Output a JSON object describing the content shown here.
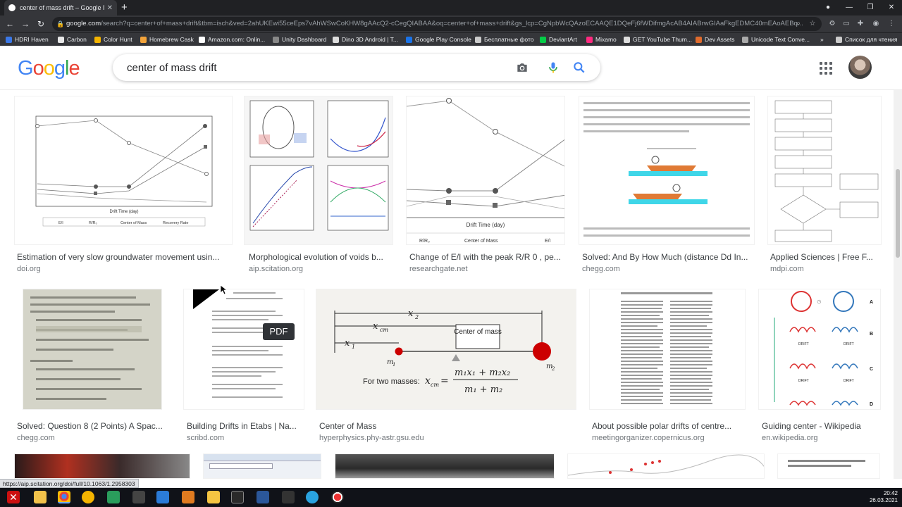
{
  "browser": {
    "tab_title": "center of mass drift – Google По",
    "address_host": "google.com",
    "address_path": "/search?q=center+of+mass+drift&tbm=isch&ved=2ahUKEwi55ceEps7vAhWSwCoKHW8gAAcQ2-cCegQIABAA&oq=center+of+mass+drift&gs_lcp=CgNpbWcQAzoECAAQE1DQeFj6fWDifmgAcAB4AIABrwGIAaFkgEDMC40mEAoAEBq...",
    "bookmarks": [
      {
        "label": "HDRI Haven",
        "color": "#3b78e7"
      },
      {
        "label": "Carbon",
        "color": "#2e2e2e"
      },
      {
        "label": "Color Hunt",
        "color": "#f4b400"
      },
      {
        "label": "Homebrew Cask",
        "color": "#f2a33a"
      },
      {
        "label": "Amazon.com: Onlin...",
        "color": "#ffffff"
      },
      {
        "label": "Unity Dashboard",
        "color": "#888888"
      },
      {
        "label": "Dino 3D Android | T...",
        "color": "#dddddd"
      },
      {
        "label": "Google Play Console",
        "color": "#1a73e8"
      },
      {
        "label": "Бесплатные фото",
        "color": "#cccccc"
      },
      {
        "label": "DeviantArt",
        "color": "#05cc47"
      },
      {
        "label": "Mixamo",
        "color": "#ff2a7f"
      },
      {
        "label": "GET YouTube Thum...",
        "color": "#dddddd"
      },
      {
        "label": "Dev Assets",
        "color": "#e06b2d"
      },
      {
        "label": "Unicode Text Conve...",
        "color": "#aaaaaa"
      },
      {
        "label": "Список для чтения",
        "color": "#cccccc"
      }
    ],
    "more_label": "»"
  },
  "google": {
    "logo_letters": [
      "G",
      "o",
      "o",
      "g",
      "l",
      "e"
    ],
    "query": "center of mass drift"
  },
  "results_row1": [
    {
      "title": "Estimation of very slow groundwater movement usin...",
      "source": "doi.org"
    },
    {
      "title": "Morphological evolution of voids b...",
      "source": "aip.scitation.org"
    },
    {
      "title": "Change of E/I with the peak R/R 0 , pe...",
      "source": "researchgate.net"
    },
    {
      "title": "Solved: And By How Much (distance Dd In...",
      "source": "chegg.com"
    },
    {
      "title": "Applied Sciences | Free F...",
      "source": "mdpi.com"
    }
  ],
  "results_row2": [
    {
      "title": "Solved: Question 8 (2 Points) A Spac...",
      "source": "chegg.com"
    },
    {
      "title": "Building Drifts in Etabs | Na...",
      "source": "scribd.com"
    },
    {
      "title": "Center of Mass",
      "source": "hyperphysics.phy-astr.gsu.edu"
    },
    {
      "title": "About possible polar drifts of centre...",
      "source": "meetingorganizer.copernicus.org"
    },
    {
      "title": "Guiding center - Wikipedia",
      "source": "en.wikipedia.org"
    }
  ],
  "thumb_texts": {
    "chart1_xlabel": "Drift Time (day)",
    "chart1_legend": [
      "E/I",
      "R/R₀",
      "Center of Mass",
      "Recovery Rate"
    ],
    "chart3_xlabel": "Drift Time (day)",
    "chart3_legend": [
      "R/R₀",
      "Center of Mass",
      "E/I"
    ],
    "com_label": "Center of mass",
    "com_formula": "For two masses:",
    "pdf_badge": "PDF",
    "guiding_labels": [
      "A",
      "B",
      "C",
      "D"
    ],
    "guiding_drift": "DRIFT"
  },
  "status_url": "https://aip.scitation.org/doi/full/10.1063/1.2958303",
  "clock": {
    "time": "20:42",
    "date": "26.03.2021"
  }
}
